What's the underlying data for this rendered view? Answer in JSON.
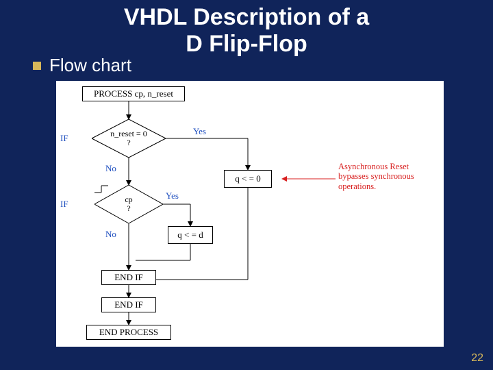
{
  "title_line1": "VHDL Description of a",
  "title_line2": "D Flip-Flop",
  "subtitle": "Flow chart",
  "page_number": "22",
  "flowchart": {
    "process_box": "PROCESS cp, n_reset",
    "if1_label": "IF",
    "diamond1_text": "n_reset = 0",
    "diamond1_q": "?",
    "branch_yes": "Yes",
    "branch_no": "No",
    "assign_q0": "q < = 0",
    "if2_label": "IF",
    "diamond2_text": "cp",
    "diamond2_q": "?",
    "assign_qd": "q < = d",
    "endif1": "END IF",
    "endif2": "END IF",
    "endprocess": "END PROCESS",
    "note_line1": "Asynchronous Reset",
    "note_line2": "bypasses synchronous",
    "note_line3": "operations."
  }
}
